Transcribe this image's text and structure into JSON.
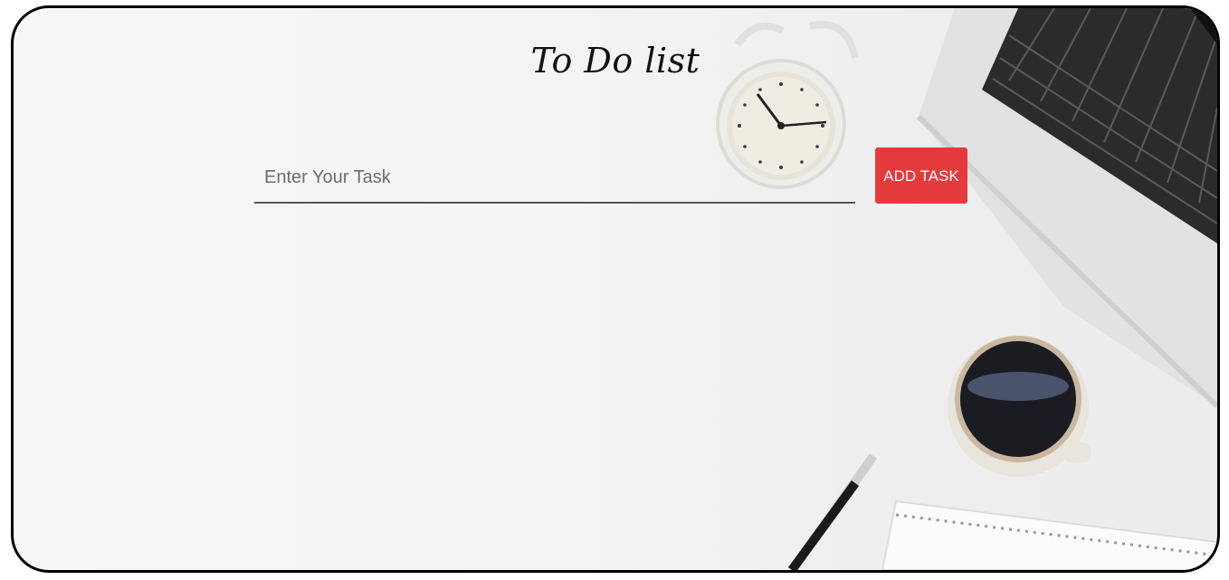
{
  "app": {
    "title": "To Do list"
  },
  "form": {
    "input_placeholder": "Enter Your Task",
    "input_value": "",
    "add_button_label": "ADD TASK"
  },
  "colors": {
    "accent": "#e43a3c",
    "frame_border": "#000000",
    "background": "#f4f4f4"
  }
}
